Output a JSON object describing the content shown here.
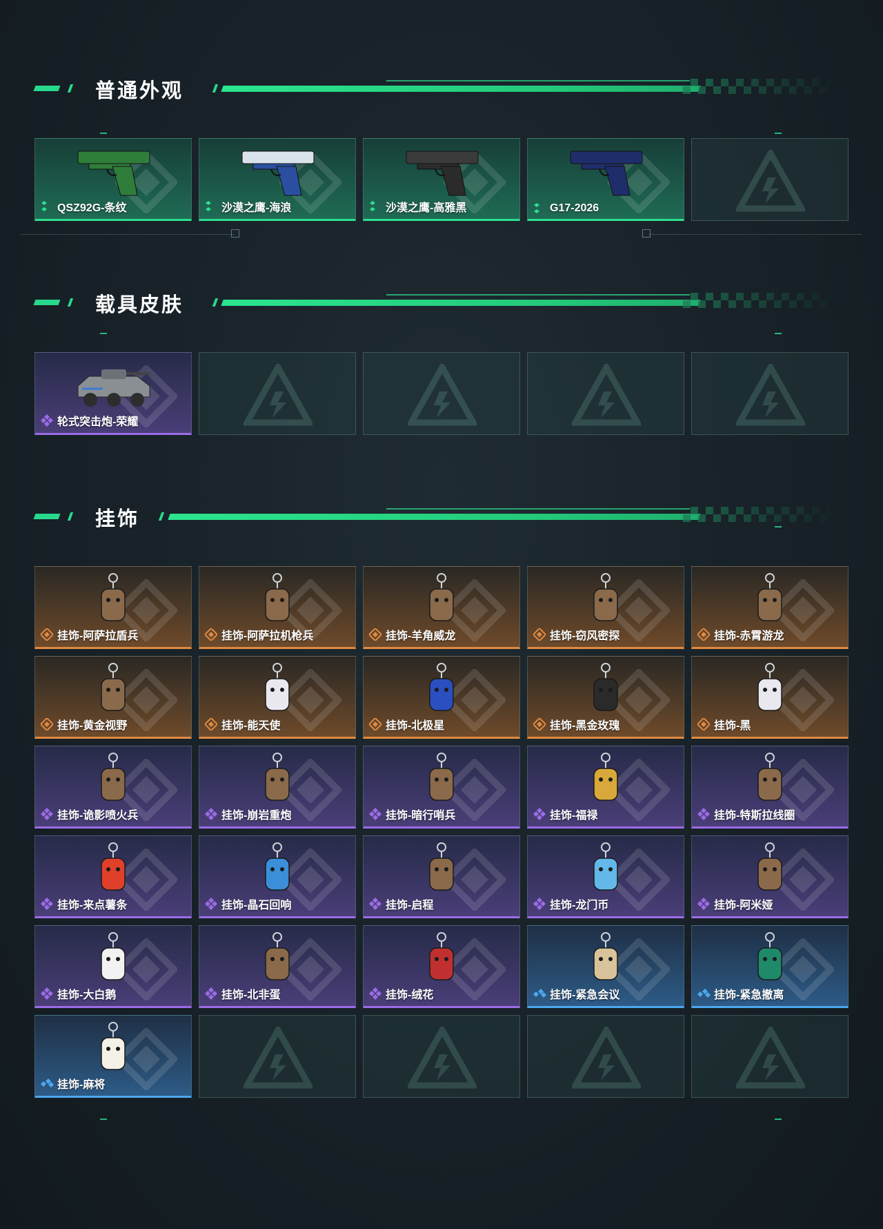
{
  "colors": {
    "accent_green": "#2be58f",
    "rarity_green": "#2ee08f",
    "rarity_purple": "#9b6ce6",
    "rarity_orange": "#e08a42",
    "rarity_blue": "#4da8f0"
  },
  "sections": [
    {
      "title": "普通外观",
      "items": [
        {
          "label": "QSZ92G-条纹",
          "rarity": "green",
          "icon": "pistol-green-icon"
        },
        {
          "label": "沙漠之鹰-海浪",
          "rarity": "green",
          "icon": "pistol-wave-icon"
        },
        {
          "label": "沙漠之鹰-高雅黑",
          "rarity": "green",
          "icon": "pistol-black-icon"
        },
        {
          "label": "G17-2026",
          "rarity": "green",
          "icon": "pistol-navy-icon"
        },
        {
          "label": "",
          "rarity": "empty",
          "icon": "empty-slot-logo-icon"
        }
      ]
    },
    {
      "title": "载具皮肤",
      "items": [
        {
          "label": "轮式突击炮-荣耀",
          "rarity": "purple",
          "icon": "armored-vehicle-icon"
        },
        {
          "label": "",
          "rarity": "empty",
          "icon": "empty-slot-logo-icon"
        },
        {
          "label": "",
          "rarity": "empty",
          "icon": "empty-slot-logo-icon"
        },
        {
          "label": "",
          "rarity": "empty",
          "icon": "empty-slot-logo-icon"
        },
        {
          "label": "",
          "rarity": "empty",
          "icon": "empty-slot-logo-icon"
        }
      ]
    },
    {
      "title": "挂饰",
      "items": [
        {
          "label": "挂饰-阿萨拉盾兵",
          "rarity": "orange",
          "icon": "charm-figure-icon"
        },
        {
          "label": "挂饰-阿萨拉机枪兵",
          "rarity": "orange",
          "icon": "charm-figure-icon"
        },
        {
          "label": "挂饰-羊角威龙",
          "rarity": "orange",
          "icon": "charm-figure-icon"
        },
        {
          "label": "挂饰-窃风密探",
          "rarity": "orange",
          "icon": "charm-figure-icon"
        },
        {
          "label": "挂饰-赤霄游龙",
          "rarity": "orange",
          "icon": "charm-figure-icon"
        },
        {
          "label": "挂饰-黄金视野",
          "rarity": "orange",
          "icon": "charm-figure-icon"
        },
        {
          "label": "挂饰-能天使",
          "rarity": "orange",
          "icon": "charm-tag-icon"
        },
        {
          "label": "挂饰-北极星",
          "rarity": "orange",
          "icon": "charm-star-icon"
        },
        {
          "label": "挂饰-黑金玫瑰",
          "rarity": "orange",
          "icon": "charm-rose-icon"
        },
        {
          "label": "挂饰-黑",
          "rarity": "orange",
          "icon": "charm-tag-icon"
        },
        {
          "label": "挂饰-诡影喷火兵",
          "rarity": "purple",
          "icon": "charm-figure-icon"
        },
        {
          "label": "挂饰-崩岩重炮",
          "rarity": "purple",
          "icon": "charm-figure-icon"
        },
        {
          "label": "挂饰-暗行哨兵",
          "rarity": "purple",
          "icon": "charm-figure-icon"
        },
        {
          "label": "挂饰-福禄",
          "rarity": "purple",
          "icon": "charm-gourd-icon"
        },
        {
          "label": "挂饰-特斯拉线圈",
          "rarity": "purple",
          "icon": "charm-coil-icon"
        },
        {
          "label": "挂饰-来点薯条",
          "rarity": "purple",
          "icon": "charm-fries-icon"
        },
        {
          "label": "挂饰-晶石回响",
          "rarity": "purple",
          "icon": "charm-crystal-icon"
        },
        {
          "label": "挂饰-启程",
          "rarity": "purple",
          "icon": "charm-medal-icon"
        },
        {
          "label": "挂饰-龙门币",
          "rarity": "purple",
          "icon": "charm-coin-icon"
        },
        {
          "label": "挂饰-阿米娅",
          "rarity": "purple",
          "icon": "charm-bunny-icon"
        },
        {
          "label": "挂饰-大白鹅",
          "rarity": "purple",
          "icon": "charm-goose-icon"
        },
        {
          "label": "挂饰-北非蛋",
          "rarity": "purple",
          "icon": "charm-pan-icon"
        },
        {
          "label": "挂饰-绒花",
          "rarity": "purple",
          "icon": "charm-flower-icon"
        },
        {
          "label": "挂饰-紧急会议",
          "rarity": "blue",
          "icon": "charm-badge-icon"
        },
        {
          "label": "挂饰-紧急撤离",
          "rarity": "blue",
          "icon": "charm-sign-icon"
        },
        {
          "label": "挂饰-麻将",
          "rarity": "blue",
          "icon": "charm-mahjong-icon"
        },
        {
          "label": "",
          "rarity": "empty",
          "icon": "empty-slot-logo-icon"
        },
        {
          "label": "",
          "rarity": "empty",
          "icon": "empty-slot-logo-icon"
        },
        {
          "label": "",
          "rarity": "empty",
          "icon": "empty-slot-logo-icon"
        },
        {
          "label": "",
          "rarity": "empty",
          "icon": "empty-slot-logo-icon"
        }
      ]
    }
  ]
}
